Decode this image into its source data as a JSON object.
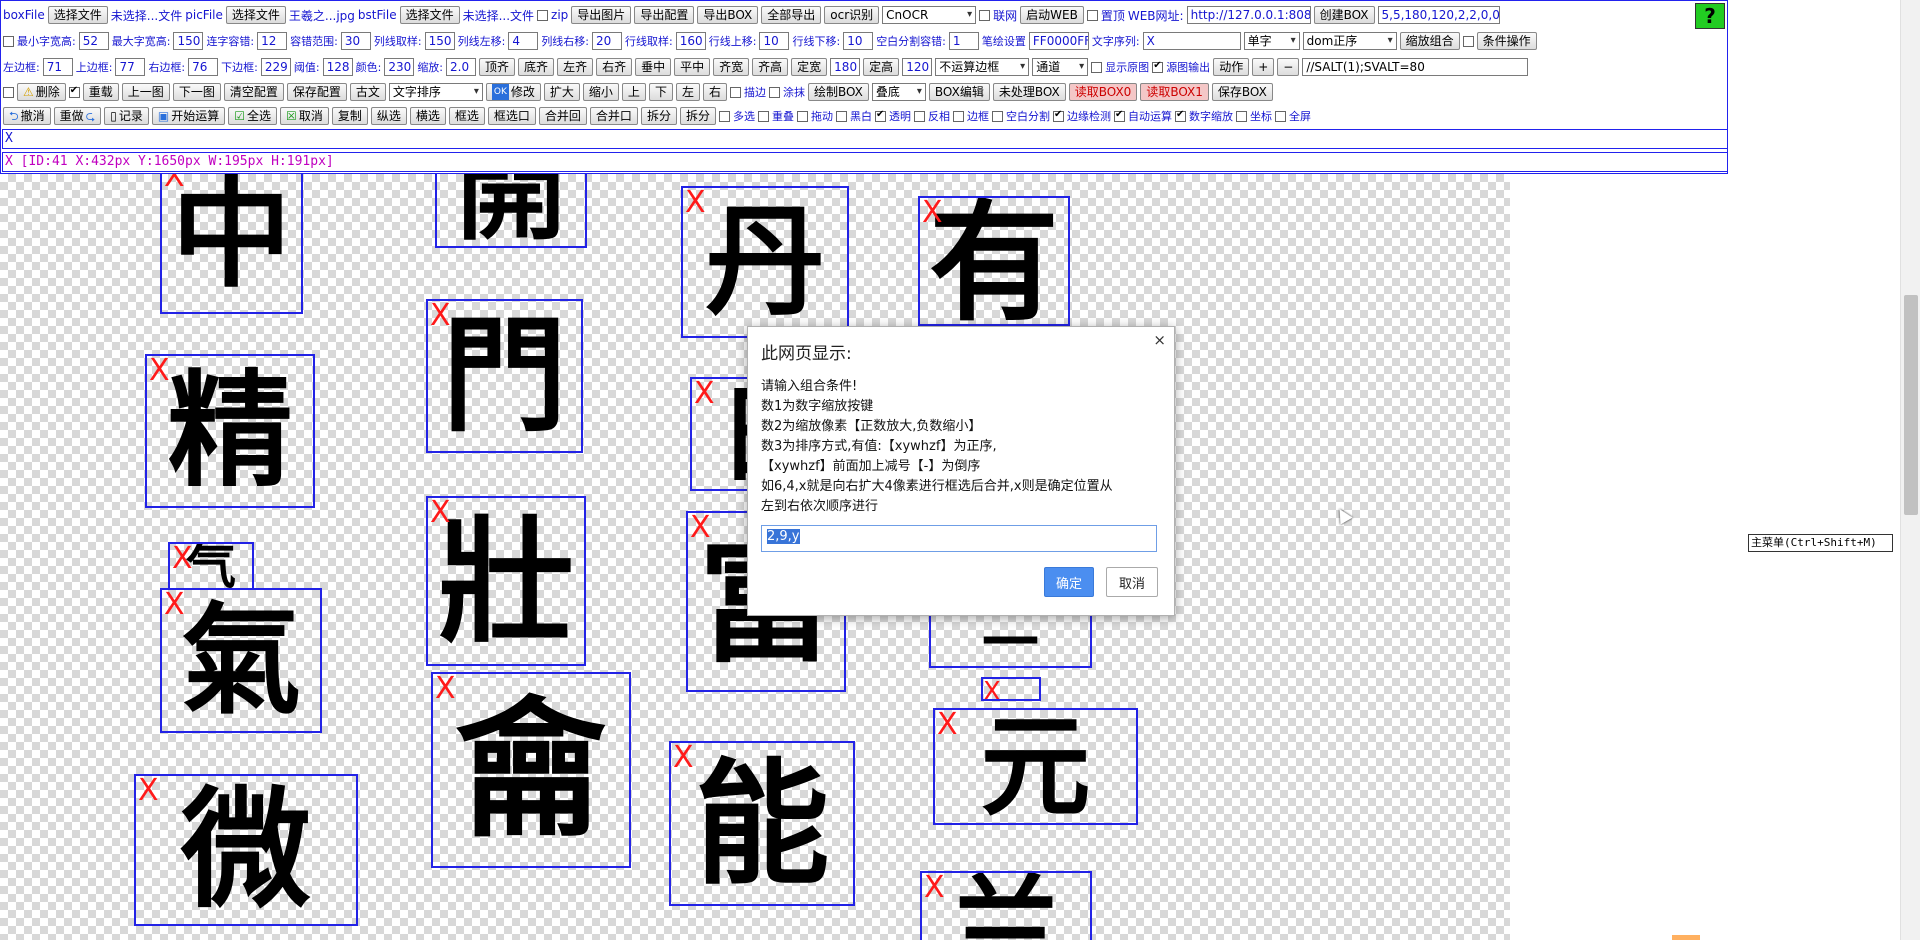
{
  "toolbar": {
    "row1": {
      "boxfile_label": "boxFile",
      "choose_file_1": "选择文件",
      "boxfile_status": "未选择...文件",
      "picfile_label": "picFile",
      "choose_file_2": "选择文件",
      "picfile_status": "王羲之...jpg",
      "bstfile_label": "bstFile",
      "choose_file_3": "选择文件",
      "bstfile_status": "未选择...文件",
      "zip_label": "zip",
      "export_image": "导出图片",
      "export_config": "导出配置",
      "export_box": "导出BOX",
      "export_all": "全部导出",
      "ocr_recognize": "ocr识别",
      "ocr_engine": "CnOCR",
      "online_label": "联网",
      "start_web": "启动WEB",
      "pin_top_label": "置顶",
      "web_url_label": "WEB网址:",
      "web_url": "http://127.0.0.1:808",
      "create_box": "创建BOX",
      "box_params": "5,5,180,120,2,2,0,0",
      "help_icon": "?"
    },
    "row2": {
      "min_char_width_label": "最小字宽高:",
      "min_char_width": "52",
      "max_char_width_label": "最大字宽高:",
      "max_char_width": "150",
      "connect_tolerance_label": "连字容错:",
      "connect_tolerance": "12",
      "tolerance_range_label": "容错范围:",
      "tolerance_range": "30",
      "col_sample_label": "列线取样:",
      "col_sample": "150",
      "col_left_label": "列线左移:",
      "col_left": "4",
      "col_right_label": "列线右移:",
      "col_right": "20",
      "row_sample_label": "行线取样:",
      "row_sample": "160",
      "row_up_label": "行线上移:",
      "row_up": "10",
      "row_down_label": "行线下移:",
      "row_down": "10",
      "blank_split_label": "空白分割容错:",
      "blank_split": "1",
      "stroke_setting_label": "笔绘设置",
      "stroke_color": "FF0000FF",
      "text_seq_label": "文字序列:",
      "text_seq": "X",
      "single_char": "单字",
      "dom_order": "dom正序",
      "zoom_combine": "缩放组合",
      "condition_op": "条件操作"
    },
    "row3": {
      "left_margin_label": "左边框:",
      "left_margin": "71",
      "top_margin_label": "上边框:",
      "top_margin": "77",
      "right_margin_label": "右边框:",
      "right_margin": "76",
      "bottom_margin_label": "下边框:",
      "bottom_margin": "229",
      "threshold_label": "阈值:",
      "threshold": "128",
      "color_label": "颜色:",
      "color": "230",
      "scale_label": "缩放:",
      "scale": "2.0",
      "align_top": "顶齐",
      "align_bottom": "底齐",
      "align_left": "左齐",
      "align_right": "右齐",
      "v_center": "垂中",
      "h_center": "平中",
      "equal_width": "齐宽",
      "equal_height": "齐高",
      "fix_width": "定宽",
      "fix_width_val": "180",
      "fix_height": "定高",
      "fix_height_val": "120",
      "no_box_calc": "不运算边框",
      "channel": "通道",
      "show_original_label": "显示原图",
      "source_output_label": "源图输出",
      "action": "动作",
      "plus": "+",
      "minus": "−",
      "salt_text": "//SALT(1);SVALT=80"
    },
    "row4": {
      "delete": "删除",
      "reload": "重载",
      "prev_image": "上一图",
      "next_image": "下一图",
      "clear_config": "清空配置",
      "save_config": "保存配置",
      "ancient_text": "古文",
      "text_sort": "文字排序",
      "ok_badge": "OK",
      "modify": "修改",
      "expand": "扩大",
      "shrink": "缩小",
      "up": "上",
      "down": "下",
      "left": "左",
      "right": "右",
      "stroke_label": "描边",
      "smear_label": "涂抹",
      "draw_box": "绘制BOX",
      "stack_bottom": "叠底",
      "box_edit": "BOX编辑",
      "unprocessed_box": "未处理BOX",
      "read_box0": "读取BOX0",
      "read_box1": "读取BOX1",
      "save_box": "保存BOX"
    },
    "row5": {
      "undo": "撤消",
      "redo": "重做",
      "record": "记录",
      "start_calc": "开始运算",
      "select_all": "全选",
      "cancel": "取消",
      "copy": "复制",
      "v_select": "纵选",
      "h_select": "横选",
      "frame_select": "框选",
      "frame_box": "框选口",
      "merge_back": "合并回",
      "merge_box": "合并口",
      "split": "拆分",
      "split_box": "拆分",
      "multi_select_label": "多选",
      "overlap_label": "重叠",
      "drag_label": "拖动",
      "black_white_label": "黑白",
      "transparent_label": "透明",
      "invert_label": "反相",
      "border_label": "边框",
      "blank_split_label": "空白分割",
      "edge_detect_label": "边缘检测",
      "auto_calc_label": "自动运算",
      "num_zoom_label": "数字缩放",
      "coords_label": "坐标",
      "fullscreen_label": "全屏"
    }
  },
  "text_line_1": "X",
  "text_line_2": "X   [ID:41  X:432px Y:1650px W:195px H:191px]",
  "canvas": {
    "boxes": [
      {
        "char": "中",
        "mark": "X"
      },
      {
        "char": "開",
        "mark": ""
      },
      {
        "char": "丹",
        "mark": "X"
      },
      {
        "char": "有",
        "mark": "X"
      },
      {
        "char": "精",
        "mark": "X"
      },
      {
        "char": "門",
        "mark": "X"
      },
      {
        "char": "日",
        "mark": "X"
      },
      {
        "char": "气",
        "mark": "X"
      },
      {
        "char": "氣",
        "mark": "X"
      },
      {
        "char": "壯",
        "mark": "X"
      },
      {
        "char": "富",
        "mark": "X"
      },
      {
        "char": "—",
        "mark": ""
      },
      {
        "char": "",
        "mark": "X"
      },
      {
        "char": "元",
        "mark": "X"
      },
      {
        "char": "微",
        "mark": "X"
      },
      {
        "char": "龠",
        "mark": "X"
      },
      {
        "char": "能",
        "mark": "X"
      },
      {
        "char": "兰",
        "mark": "X"
      }
    ]
  },
  "dialog": {
    "title": "此网页显示:",
    "close_icon": "×",
    "messages": [
      "请输入组合条件!",
      "数1为数字缩放按键",
      "数2为缩放像素【正数放大,负数缩小】",
      "数3为排序方式,有值:【xywhzf】为正序,",
      "【xywhzf】前面加上减号【-】为倒序",
      "如6,4,x就是向右扩大4像素进行框选后合并,x则是确定位置从",
      "左到右依次顺序进行"
    ],
    "input_value": "2,9,y",
    "ok_label": "确定",
    "cancel_label": "取消"
  },
  "tooltip": "主菜单(Ctrl+Shift+M)"
}
